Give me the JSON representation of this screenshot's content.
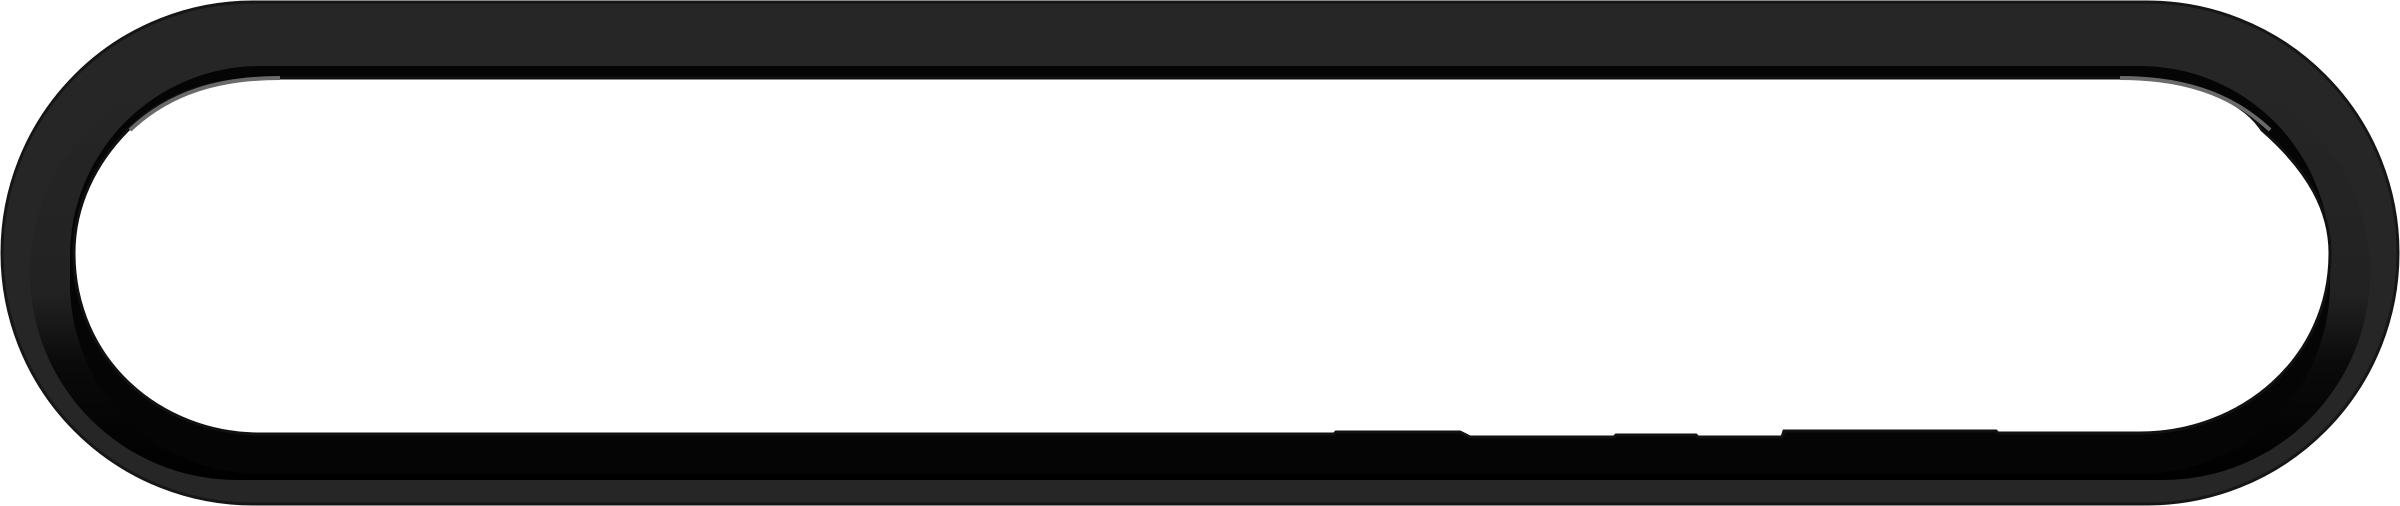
{
  "frame": {
    "shape": "rounded-pill-bezel",
    "colors": {
      "outer_ring": "#262626",
      "outer_edge": "#161616",
      "inner_shadow": "#050505",
      "inner_face": "#ffffff",
      "highlight": "#e0e0e0"
    }
  }
}
